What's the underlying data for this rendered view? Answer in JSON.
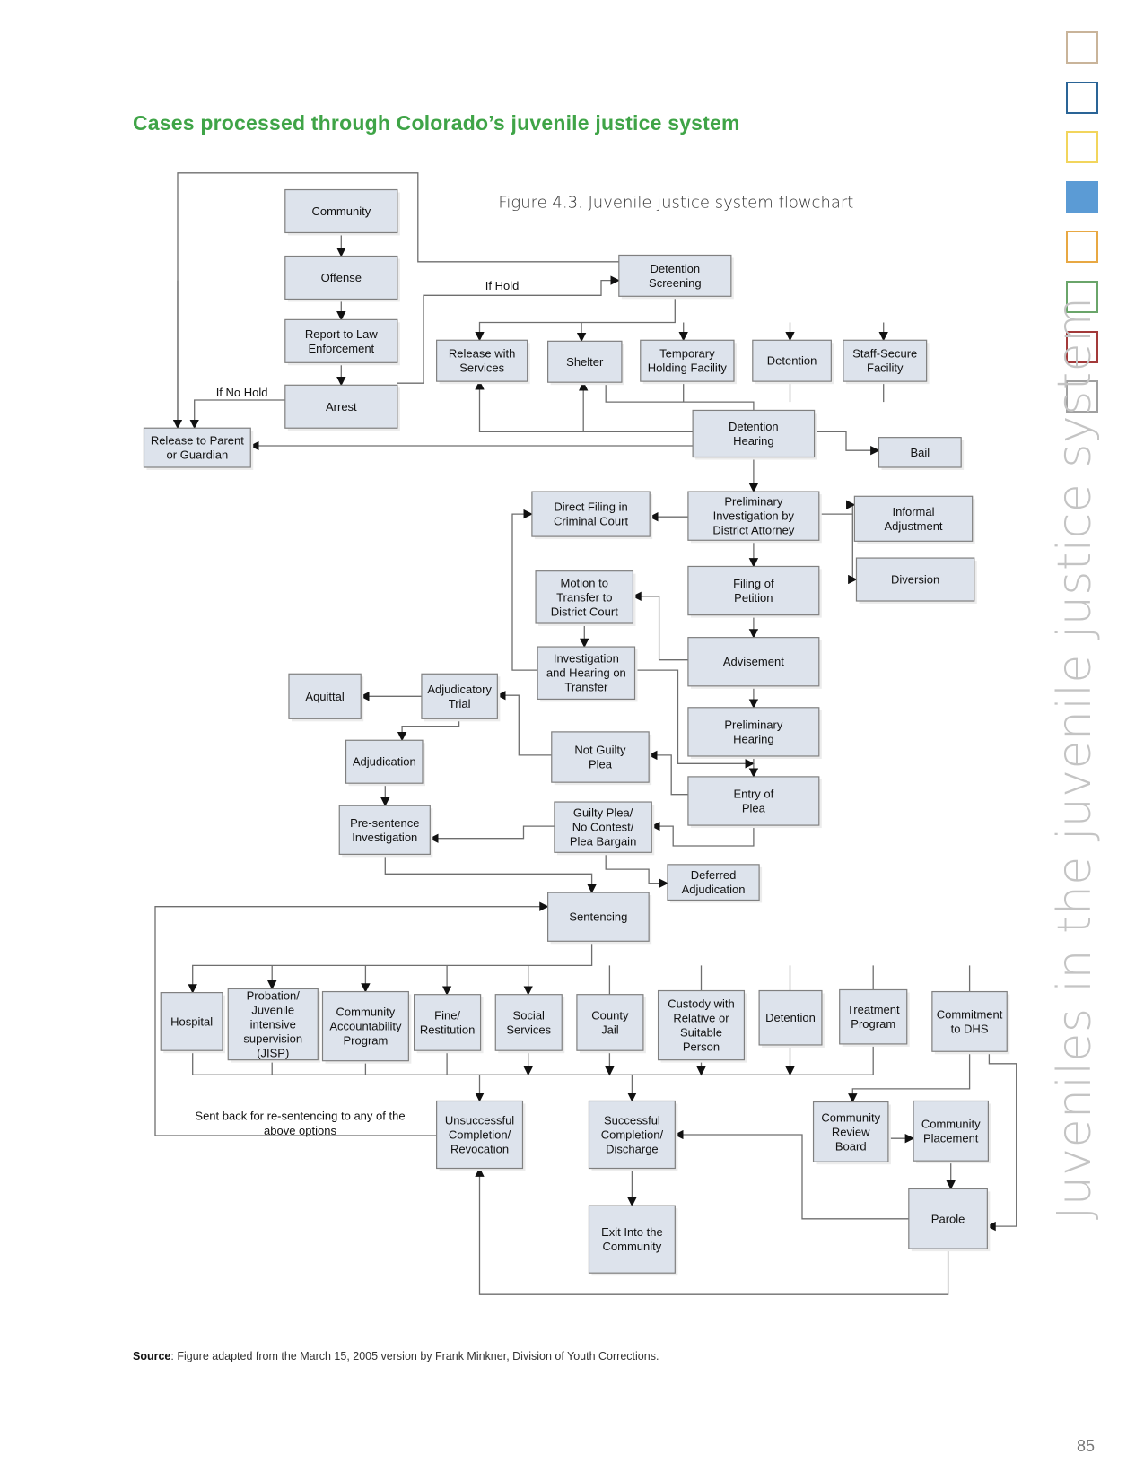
{
  "page": {
    "title": "Cases processed through Colorado’s juvenile justice system",
    "side_heading": "Juveniles in the juvenile justice system",
    "page_number": "85",
    "source_label": "Source",
    "source_text": ": Figure adapted from the March 15, 2005 version by Frank Minkner, Division of Youth Corrections.",
    "section_tabs": [
      {
        "color": "#c9b49a",
        "filled": false
      },
      {
        "color": "#2a6496",
        "filled": false
      },
      {
        "color": "#f2d55c",
        "filled": false
      },
      {
        "color": "#5b9bd5",
        "filled": true
      },
      {
        "color": "#e8a843",
        "filled": false
      },
      {
        "color": "#6aa56a",
        "filled": false
      },
      {
        "color": "#a33a3a",
        "filled": false
      },
      {
        "color": "#a0a0a0",
        "filled": false
      }
    ],
    "colors": {
      "title": "#3fa447",
      "node_fill": "#dde3ec",
      "node_border": "#808080",
      "edge": "#6e6e6e"
    }
  },
  "figure": {
    "caption": "Figure 4.3. Juvenile justice system flowchart",
    "nodes": {
      "community": [
        "Community"
      ],
      "offense": [
        "Offense"
      ],
      "report": [
        "Report to Law",
        "Enforcement"
      ],
      "arrest": [
        "Arrest"
      ],
      "release_parent": [
        "Release to Parent",
        "or Guardian"
      ],
      "det_screening": [
        "Detention",
        "Screening"
      ],
      "release_services": [
        "Release with",
        "Services"
      ],
      "shelter": [
        "Shelter"
      ],
      "temp_holding": [
        "Temporary",
        "Holding Facility"
      ],
      "detention1": [
        "Detention"
      ],
      "staff_secure": [
        "Staff-Secure",
        "Facility"
      ],
      "det_hearing": [
        "Detention",
        "Hearing"
      ],
      "bail": [
        "Bail"
      ],
      "prelim_invest": [
        "Preliminary",
        "Investigation by",
        "District Attorney"
      ],
      "direct_filing": [
        "Direct Filing in",
        "Criminal Court"
      ],
      "informal_adj": [
        "Informal",
        "Adjustment"
      ],
      "diversion": [
        "Diversion"
      ],
      "filing_petition": [
        "Filing of",
        "Petition"
      ],
      "motion_transfer": [
        "Motion to",
        "Transfer to",
        "District Court"
      ],
      "advisement": [
        "Advisement"
      ],
      "invest_hearing": [
        "Investigation",
        "and Hearing on",
        "Transfer"
      ],
      "adj_trial": [
        "Adjudicatory",
        "Trial"
      ],
      "aquittal": [
        "Aquittal"
      ],
      "prelim_hearing": [
        "Preliminary",
        "Hearing"
      ],
      "adjudication": [
        "Adjudication"
      ],
      "not_guilty": [
        "Not Guilty",
        "Plea"
      ],
      "entry_plea": [
        "Entry of",
        "Plea"
      ],
      "presentence": [
        "Pre-sentence",
        "Investigation"
      ],
      "guilty_plea": [
        "Guilty Plea/",
        "No Contest/",
        "Plea Bargain"
      ],
      "deferred": [
        "Deferred",
        "Adjudication"
      ],
      "sentencing": [
        "Sentencing"
      ],
      "hospital": [
        "Hospital"
      ],
      "probation": [
        "Probation/",
        "Juvenile",
        "intensive",
        "supervision",
        "(JISP)"
      ],
      "cap": [
        "Community",
        "Accountability",
        "Program"
      ],
      "fine": [
        "Fine/",
        "Restitution"
      ],
      "social": [
        "Social",
        "Services"
      ],
      "county_jail": [
        "County",
        "Jail"
      ],
      "custody": [
        "Custody with",
        "Relative or",
        "Suitable",
        "Person"
      ],
      "detention2": [
        "Detention"
      ],
      "treatment": [
        "Treatment",
        "Program"
      ],
      "commitment": [
        "Commitment",
        "to DHS"
      ],
      "unsuccessful": [
        "Unsuccessful",
        "Completion/",
        "Revocation"
      ],
      "successful": [
        "Successful",
        "Completion/",
        "Discharge"
      ],
      "crb": [
        "Community",
        "Review",
        "Board"
      ],
      "comm_placement": [
        "Community",
        "Placement"
      ],
      "exit": [
        "Exit Into the",
        "Community"
      ],
      "parole": [
        "Parole"
      ]
    },
    "edge_labels": {
      "if_hold": "If Hold",
      "if_no_hold": "If No Hold",
      "resentence": [
        "Sent back for re-sentencing to any of the",
        "above options"
      ]
    }
  }
}
